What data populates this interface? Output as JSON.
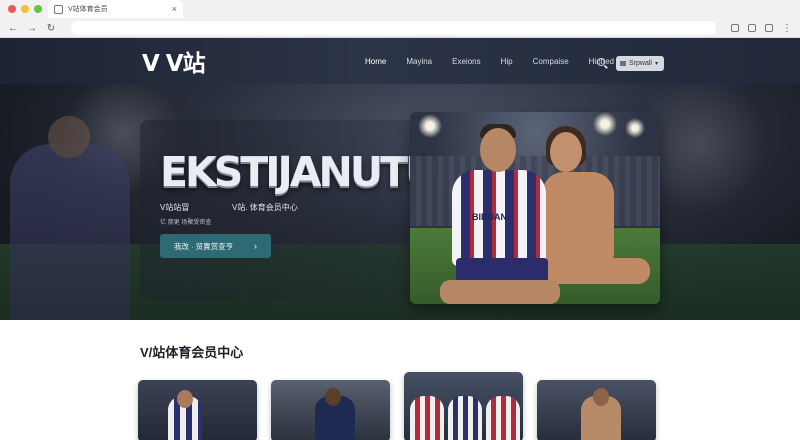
{
  "browser": {
    "tab_title": "V站体育会员",
    "tab_close": "×",
    "nav": {
      "back": "←",
      "forward": "→",
      "reload": "↻",
      "menu": "⋮"
    }
  },
  "header": {
    "logo": "V V站",
    "nav": [
      "Home",
      "Mayina",
      "Exeions",
      "Hip",
      "Compaise",
      "Hintted"
    ],
    "active_index": 0,
    "language": {
      "label": "Srpwall",
      "caret": "▾"
    }
  },
  "hero": {
    "title": "EKSTIJANUTUI",
    "subtitle_left": "V站站冒",
    "subtitle_right": "V站. 体育会员中心",
    "note": "亿 那更   场聚受密查",
    "button": {
      "label": "我改 · 贸賣赏查亨",
      "arrow": "›"
    },
    "jersey_text": "BIRDAN"
  },
  "section": {
    "title": "V/站体育会员中心",
    "cards": [
      {
        "name": "card-1"
      },
      {
        "name": "card-2"
      },
      {
        "name": "card-3"
      },
      {
        "name": "card-4"
      }
    ]
  },
  "colors": {
    "header_bg": "#2c3447",
    "hero_button": "#2e6a74",
    "page_bg": "#ffffff"
  },
  "icons": [
    "back-icon",
    "forward-icon",
    "reload-icon",
    "search-icon",
    "chevron-down-icon",
    "menu-icon"
  ]
}
